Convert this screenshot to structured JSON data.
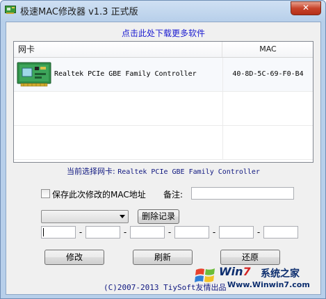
{
  "window": {
    "title": "极速MAC修改器 v1.3 正式版",
    "close_symbol": "✕"
  },
  "links": {
    "download_more": "点击此处下载更多软件"
  },
  "nic_list": {
    "headers": {
      "nic": "网卡",
      "mac": "MAC"
    },
    "rows": [
      {
        "name": "Realtek PCIe GBE Family Controller",
        "mac": "40-8D-5C-69-F0-B4",
        "icon": "network-card-icon"
      }
    ]
  },
  "current_selection": {
    "label": "当前选择网卡: ",
    "value": "Realtek PCIe GBE Family Controller"
  },
  "options": {
    "save_label": "保存此次修改的MAC地址",
    "note_label": "备注:",
    "note_value": "",
    "save_checked": false
  },
  "history": {
    "selected": "",
    "delete_label": "删除记录"
  },
  "mac_fields": [
    "",
    "",
    "",
    "",
    "",
    ""
  ],
  "mac_separator": "-",
  "buttons": {
    "modify": "修改",
    "refresh": "刷新",
    "restore": "还原"
  },
  "footer": {
    "copyright": "(C)2007-2013 TiySoft友情出品"
  },
  "watermark": {
    "brand_prefix": "Win",
    "brand_seven": "7",
    "brand_cn": "系统之家",
    "url": "Www.Winwin7.com"
  },
  "colors": {
    "link": "#1a1ad0",
    "info_text": "#101880",
    "close_button": "#c7432a",
    "watermark_blue": "#0b2d6e",
    "watermark_red": "#d32424"
  }
}
